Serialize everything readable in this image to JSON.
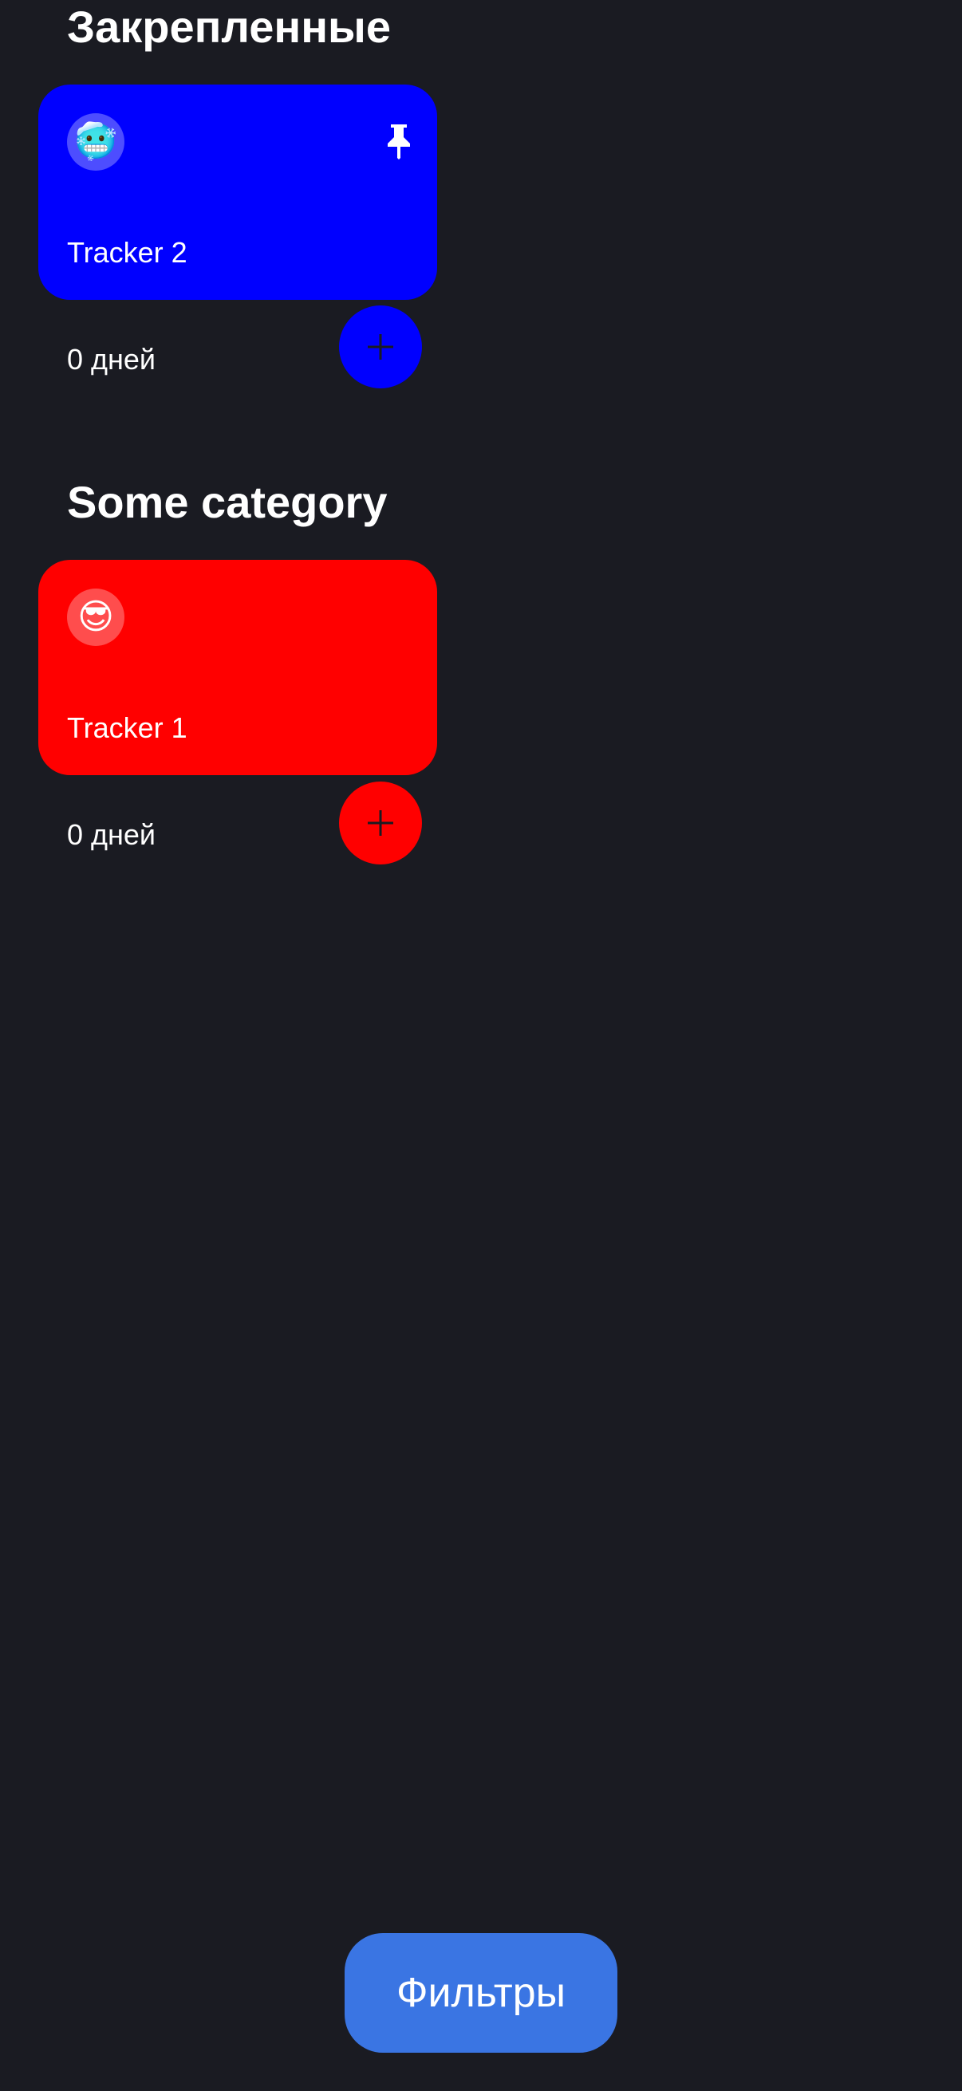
{
  "sections": [
    {
      "title": "Закрепленные",
      "tracker": {
        "name": "Tracker 2",
        "emoji": "🥶",
        "days": "0 дней",
        "color": "#0000ff",
        "pinned": true,
        "pin_icon": "pin-icon",
        "add_icon": "plus-icon"
      }
    },
    {
      "title": "Some category",
      "tracker": {
        "name": "Tracker 1",
        "emoji": "😎",
        "days": "0 дней",
        "color": "#ff0000",
        "pinned": false,
        "add_icon": "plus-icon"
      }
    }
  ],
  "filters_button": {
    "label": "Фильтры",
    "color": "#3a75e3"
  }
}
